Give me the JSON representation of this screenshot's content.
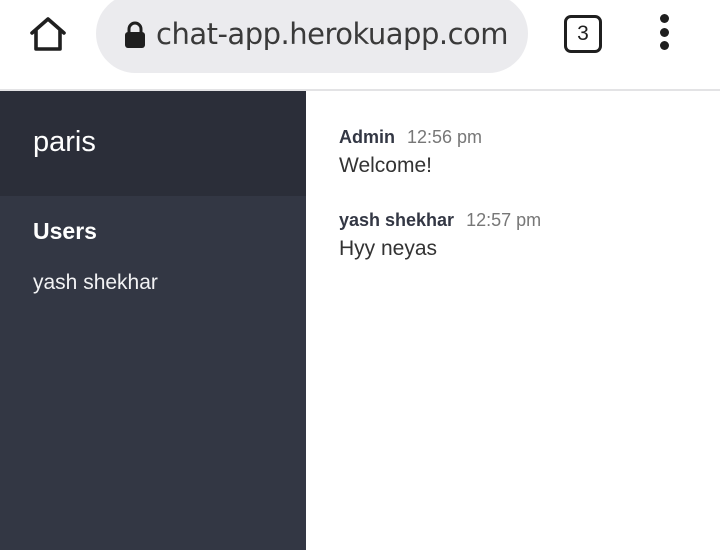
{
  "browser": {
    "url": "chat-app.herokuapp.com",
    "tab_count": "3",
    "icons": {
      "home": "home-icon",
      "lock": "lock-icon",
      "tabs": "tab-switcher-icon",
      "menu": "more-vertical-icon"
    }
  },
  "sidebar": {
    "room_name": "paris",
    "users_title": "Users",
    "users": [
      "yash shekhar"
    ]
  },
  "messages": [
    {
      "author": "Admin",
      "time": "12:56 pm",
      "text": "Welcome!"
    },
    {
      "author": "yash shekhar",
      "time": "12:57 pm",
      "text": "Hyy neyas"
    }
  ],
  "colors": {
    "sidebar_bg": "#333744",
    "room_header_bg": "#2b2e39",
    "url_pill_bg": "#ebebee"
  }
}
